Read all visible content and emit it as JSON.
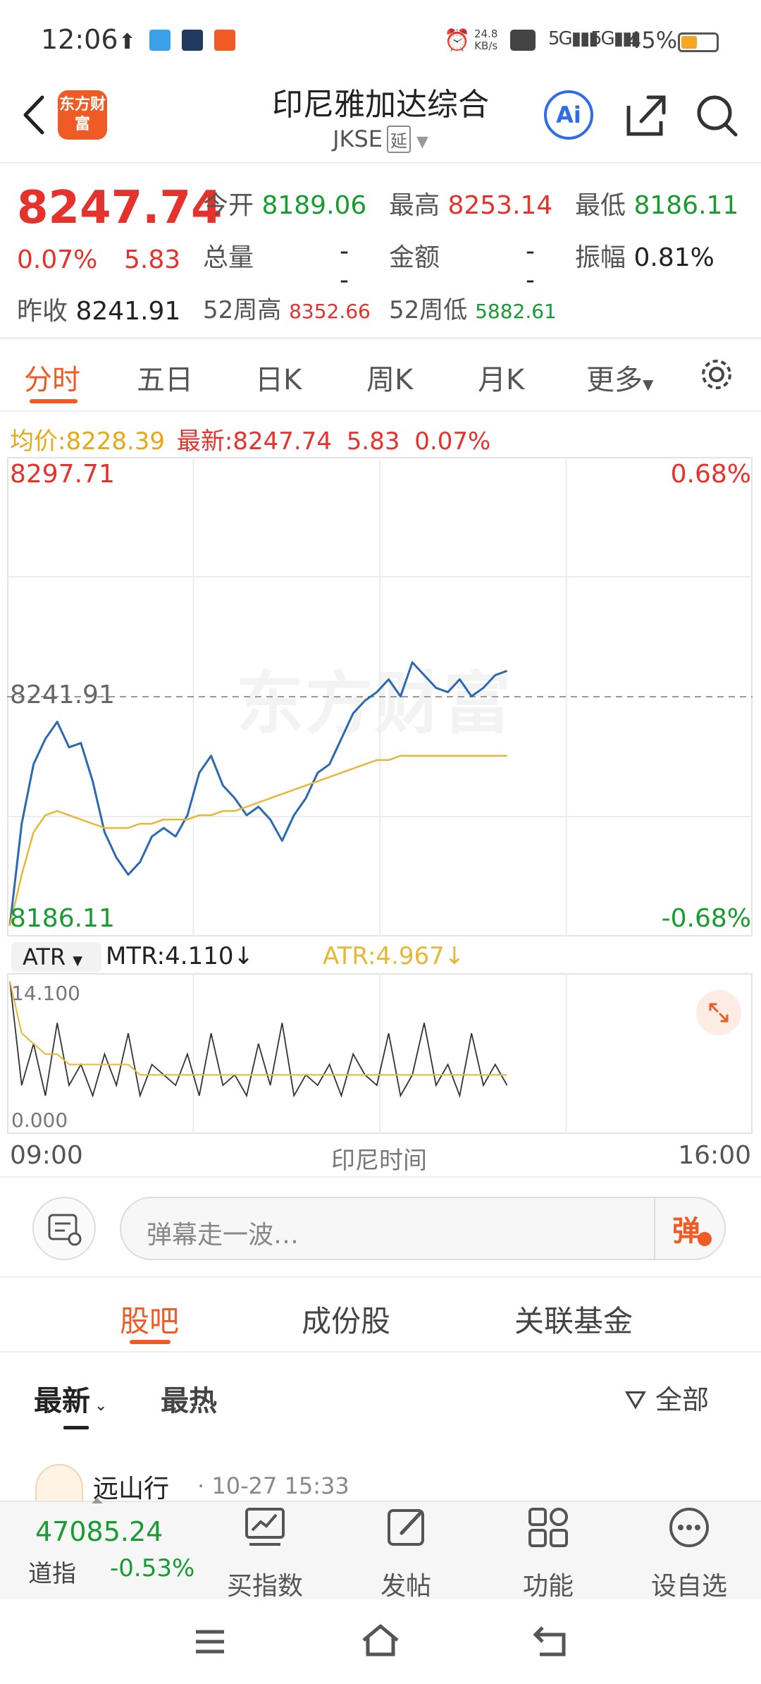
{
  "status": {
    "time": "12:06",
    "net_speed": "24.8",
    "net_unit": "KB/s",
    "battery": "45%",
    "battery_level": 0.45
  },
  "header": {
    "logo": "东方财富",
    "title": "印尼雅加达综合",
    "code": "JKSE",
    "tag": "延",
    "ai": "Ai"
  },
  "quote": {
    "price": "8247.74",
    "change_pct": "0.07%",
    "change": "5.83",
    "prev_close_label": "昨收",
    "prev_close": "8241.91",
    "open_label": "今开",
    "open": "8189.06",
    "high_label": "最高",
    "high": "8253.14",
    "low_label": "最低",
    "low": "8186.11",
    "volume_label": "总量",
    "volume": "--",
    "amount_label": "金额",
    "amount": "--",
    "amplitude_label": "振幅",
    "amplitude": "0.81%",
    "w52_high_label": "52周高",
    "w52_high": "8352.66",
    "w52_low_label": "52周低",
    "w52_low": "5882.61"
  },
  "tabs": [
    "分时",
    "五日",
    "日K",
    "周K",
    "月K",
    "更多"
  ],
  "legend": {
    "avg_label": "均价:",
    "avg": "8228.39",
    "latest_label": "最新:",
    "latest": "8247.74",
    "chg": "5.83",
    "pct": "0.07%"
  },
  "chart_labels": {
    "top": "8297.71",
    "mid": "8241.91",
    "bottom": "8186.11",
    "top_pct": "0.68%",
    "bottom_pct": "-0.68%",
    "watermark": "东方财富",
    "x_start": "09:00",
    "x_mid": "印尼时间",
    "x_end": "16:00"
  },
  "indicator": {
    "name": "ATR",
    "mtr": "MTR:4.110",
    "atr": "ATR:4.967",
    "top": "14.100",
    "bottom": "0.000"
  },
  "danmu": {
    "placeholder": "弹幕走一波…",
    "send": "弹"
  },
  "section_tabs": [
    "股吧",
    "成份股",
    "关联基金"
  ],
  "feed": {
    "sort_latest": "最新",
    "sort_hot": "最热",
    "filter": "全部",
    "first_user": "远山行",
    "first_time": "10-27 15:33"
  },
  "bottom_nav": {
    "dji_value": "47085.24",
    "dji_label": "道指",
    "dji_pct": "-0.53%",
    "items": [
      "买指数",
      "发帖",
      "功能",
      "设自选"
    ]
  },
  "colors": {
    "up": "#e5322d",
    "down": "#189c32",
    "accent": "#f05a24",
    "price_line": "#2a6ab3",
    "avg_line": "#e6b838"
  },
  "chart_data": {
    "type": "line",
    "x_range": [
      "09:00",
      "16:00"
    ],
    "y_range": [
      8186.11,
      8297.71
    ],
    "prev_close": 8241.91,
    "series": [
      {
        "name": "最新",
        "values": [
          8188,
          8212,
          8226,
          8232,
          8236,
          8230,
          8231,
          8222,
          8210,
          8204,
          8200,
          8203,
          8209,
          8211,
          8209,
          8214,
          8224,
          8228,
          8221,
          8218,
          8214,
          8216,
          8213,
          8208,
          8214,
          8218,
          8224,
          8226,
          8232,
          8238,
          8241,
          8243,
          8246,
          8242,
          8250,
          8247,
          8244,
          8243,
          8246,
          8242,
          8244,
          8247,
          8248
        ]
      },
      {
        "name": "均价",
        "values": [
          8188,
          8200,
          8210,
          8214,
          8215,
          8214,
          8213,
          8212,
          8211,
          8211,
          8211,
          8212,
          8212,
          8213,
          8213,
          8213,
          8214,
          8214,
          8215,
          8215,
          8216,
          8217,
          8218,
          8219,
          8220,
          8221,
          8222,
          8223,
          8224,
          8225,
          8226,
          8227,
          8227,
          8228,
          8228,
          8228,
          8228,
          8228,
          8228,
          8228,
          8228,
          8228,
          8228
        ]
      }
    ],
    "indicator": {
      "type": "line",
      "y_range": [
        0,
        14.1
      ],
      "mtr": [
        14,
        4,
        8,
        3,
        10,
        4,
        6,
        3,
        7,
        4,
        9,
        3,
        6,
        5,
        4,
        7,
        3,
        9,
        4,
        5,
        3,
        8,
        4,
        10,
        3,
        5,
        4,
        6,
        3,
        7,
        5,
        4,
        9,
        3,
        5,
        10,
        4,
        6,
        3,
        9,
        4,
        6,
        4
      ],
      "atr": [
        14,
        9,
        8,
        7,
        7,
        6,
        6,
        6,
        6,
        6,
        6,
        5,
        5,
        5,
        5,
        5,
        5,
        5,
        5,
        5,
        5,
        5,
        5,
        5,
        5,
        5,
        5,
        5,
        5,
        5,
        5,
        5,
        5,
        5,
        5,
        5,
        5,
        5,
        5,
        5,
        5,
        5,
        5
      ]
    }
  }
}
